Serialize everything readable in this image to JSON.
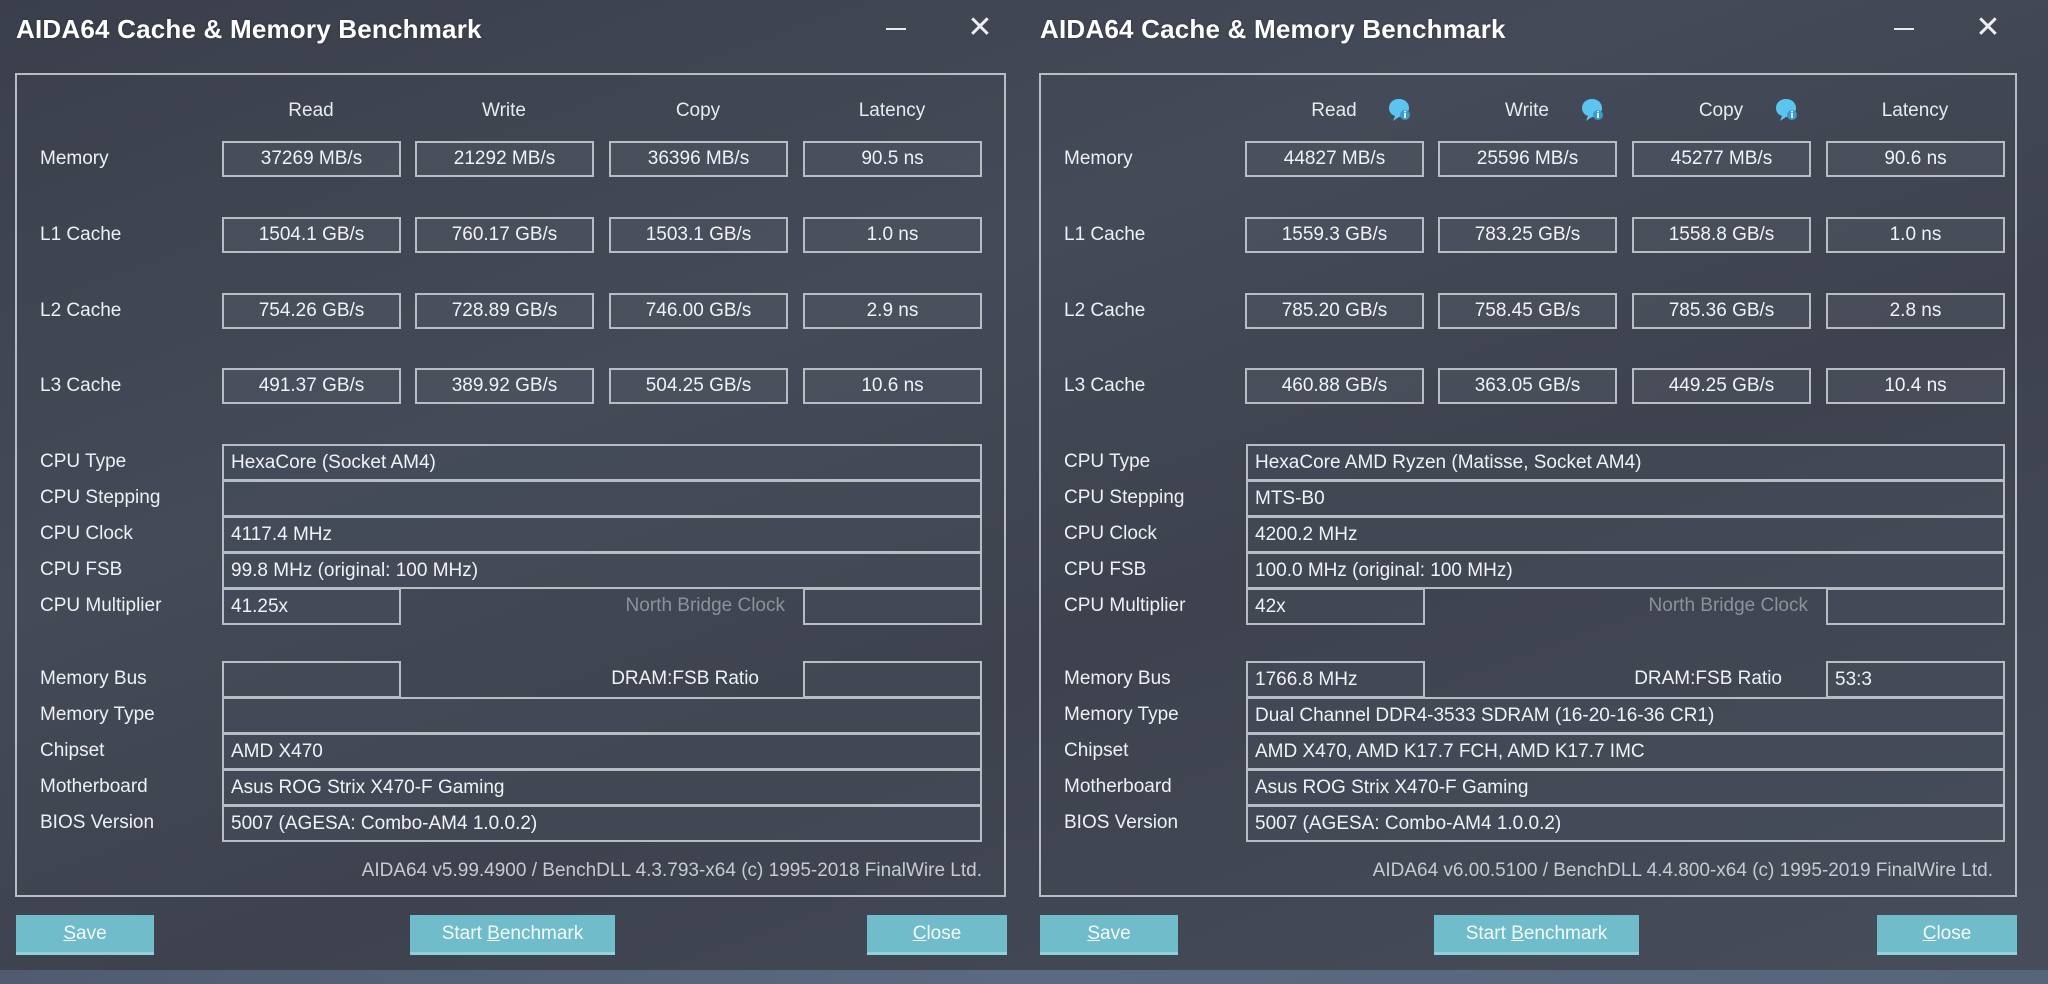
{
  "windows": [
    {
      "title": "AIDA64 Cache & Memory Benchmark",
      "columns": [
        "Read",
        "Write",
        "Copy",
        "Latency"
      ],
      "show_info_icons": false,
      "rows": [
        {
          "label": "Memory",
          "values": [
            "37269 MB/s",
            "21292 MB/s",
            "36396 MB/s",
            "90.5 ns"
          ]
        },
        {
          "label": "L1 Cache",
          "values": [
            "1504.1 GB/s",
            "760.17 GB/s",
            "1503.1 GB/s",
            "1.0 ns"
          ]
        },
        {
          "label": "L2 Cache",
          "values": [
            "754.26 GB/s",
            "728.89 GB/s",
            "746.00 GB/s",
            "2.9 ns"
          ]
        },
        {
          "label": "L3 Cache",
          "values": [
            "491.37 GB/s",
            "389.92 GB/s",
            "504.25 GB/s",
            "10.6 ns"
          ]
        }
      ],
      "cpu_info": {
        "cpu_type": {
          "label": "CPU Type",
          "value": "HexaCore   (Socket AM4)"
        },
        "cpu_stepping": {
          "label": "CPU Stepping",
          "value": ""
        },
        "cpu_clock": {
          "label": "CPU Clock",
          "value": "4117.4 MHz"
        },
        "cpu_fsb": {
          "label": "CPU FSB",
          "value": "99.8 MHz  (original: 100 MHz)"
        },
        "cpu_multiplier": {
          "label": "CPU Multiplier",
          "value": "41.25x"
        },
        "north_bridge_clock": {
          "label": "North Bridge Clock",
          "value": ""
        }
      },
      "memory_info": {
        "memory_bus": {
          "label": "Memory Bus",
          "value": ""
        },
        "dram_fsb_ratio": {
          "label": "DRAM:FSB Ratio",
          "value": ""
        },
        "memory_type": {
          "label": "Memory Type",
          "value": ""
        },
        "chipset": {
          "label": "Chipset",
          "value": "AMD X470"
        },
        "motherboard": {
          "label": "Motherboard",
          "value": "Asus ROG Strix X470-F Gaming"
        },
        "bios_version": {
          "label": "BIOS Version",
          "value": "5007  (AGESA: Combo-AM4 1.0.0.2)"
        }
      },
      "footer": "AIDA64 v5.99.4900 / BenchDLL 4.3.793-x64  (c) 1995-2018 FinalWire Ltd.",
      "buttons": {
        "save": {
          "accel": "S",
          "rest": "ave"
        },
        "start": {
          "pre": "Start ",
          "accel": "B",
          "rest": "enchmark"
        },
        "close": {
          "accel": "C",
          "rest": "lose"
        }
      }
    },
    {
      "title": "AIDA64 Cache & Memory Benchmark",
      "columns": [
        "Read",
        "Write",
        "Copy",
        "Latency"
      ],
      "show_info_icons": true,
      "rows": [
        {
          "label": "Memory",
          "values": [
            "44827 MB/s",
            "25596 MB/s",
            "45277 MB/s",
            "90.6 ns"
          ]
        },
        {
          "label": "L1 Cache",
          "values": [
            "1559.3 GB/s",
            "783.25 GB/s",
            "1558.8 GB/s",
            "1.0 ns"
          ]
        },
        {
          "label": "L2 Cache",
          "values": [
            "785.20 GB/s",
            "758.45 GB/s",
            "785.36 GB/s",
            "2.8 ns"
          ]
        },
        {
          "label": "L3 Cache",
          "values": [
            "460.88 GB/s",
            "363.05 GB/s",
            "449.25 GB/s",
            "10.4 ns"
          ]
        }
      ],
      "cpu_info": {
        "cpu_type": {
          "label": "CPU Type",
          "value": "HexaCore AMD Ryzen  (Matisse, Socket AM4)"
        },
        "cpu_stepping": {
          "label": "CPU Stepping",
          "value": "MTS-B0"
        },
        "cpu_clock": {
          "label": "CPU Clock",
          "value": "4200.2 MHz"
        },
        "cpu_fsb": {
          "label": "CPU FSB",
          "value": "100.0 MHz  (original: 100 MHz)"
        },
        "cpu_multiplier": {
          "label": "CPU Multiplier",
          "value": "42x"
        },
        "north_bridge_clock": {
          "label": "North Bridge Clock",
          "value": ""
        }
      },
      "memory_info": {
        "memory_bus": {
          "label": "Memory Bus",
          "value": "1766.8 MHz"
        },
        "dram_fsb_ratio": {
          "label": "DRAM:FSB Ratio",
          "value": "53:3"
        },
        "memory_type": {
          "label": "Memory Type",
          "value": "Dual Channel DDR4-3533 SDRAM  (16-20-16-36 CR1)"
        },
        "chipset": {
          "label": "Chipset",
          "value": "AMD X470, AMD K17.7 FCH, AMD K17.7 IMC"
        },
        "motherboard": {
          "label": "Motherboard",
          "value": "Asus ROG Strix X470-F Gaming"
        },
        "bios_version": {
          "label": "BIOS Version",
          "value": "5007  (AGESA: Combo-AM4 1.0.0.2)"
        }
      },
      "footer": "AIDA64 v6.00.5100 / BenchDLL 4.4.800-x64  (c) 1995-2019 FinalWire Ltd.",
      "buttons": {
        "save": {
          "accel": "S",
          "rest": "ave"
        },
        "start": {
          "pre": "Start ",
          "accel": "B",
          "rest": "enchmark"
        },
        "close": {
          "accel": "C",
          "rest": "lose"
        }
      }
    }
  ],
  "icons": {
    "minimize": "minimize-icon",
    "close": "close-icon",
    "close_glyph": "✕",
    "info": "info-bubble-icon"
  },
  "colors": {
    "button_bg": "#70bccb",
    "info_icon": "#5bc4ef",
    "frame_border": "#b8bcc4",
    "dim_label": "#8c929c"
  }
}
